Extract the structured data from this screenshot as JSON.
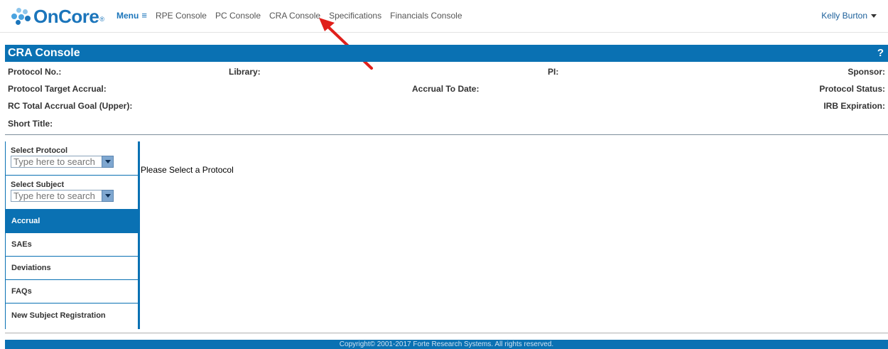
{
  "topbar": {
    "logo_text": "OnCore",
    "logo_reg": "®",
    "menu_label": "Menu",
    "menu_icon": "≡",
    "nav_items": [
      "RPE Console",
      "PC Console",
      "CRA Console",
      "Specifications",
      "Financials Console"
    ],
    "user_name": "Kelly Burton",
    "logo_colors": [
      "#8dc5eb",
      "#4aa3df",
      "#1b75bb"
    ]
  },
  "console": {
    "title": "CRA Console",
    "help": "?"
  },
  "info": {
    "protocol_no": "Protocol No.:",
    "library": "Library:",
    "pi": "PI:",
    "sponsor": "Sponsor:",
    "target_accrual": "Protocol Target Accrual:",
    "accrual_to_date": "Accrual To Date:",
    "protocol_status": "Protocol Status:",
    "rc_total": "RC Total Accrual Goal (Upper):",
    "irb_expiration": "IRB Expiration:",
    "short_title": "Short Title:"
  },
  "sidebar": {
    "select_protocol": {
      "label": "Select Protocol",
      "placeholder": "Type here to search"
    },
    "select_subject": {
      "label": "Select Subject",
      "placeholder": "Type here to search"
    },
    "items": [
      {
        "label": "Accrual",
        "active": true
      },
      {
        "label": "SAEs",
        "active": false
      },
      {
        "label": "Deviations",
        "active": false
      },
      {
        "label": "FAQs",
        "active": false
      },
      {
        "label": "New Subject Registration",
        "active": false
      }
    ]
  },
  "main": {
    "message": "Please Select a Protocol"
  },
  "footer": {
    "copyright": "Copyright© 2001-2017 Forte Research Systems. All rights reserved."
  },
  "colors": {
    "brand": "#0a71b3",
    "arrow": "#e0201b"
  }
}
